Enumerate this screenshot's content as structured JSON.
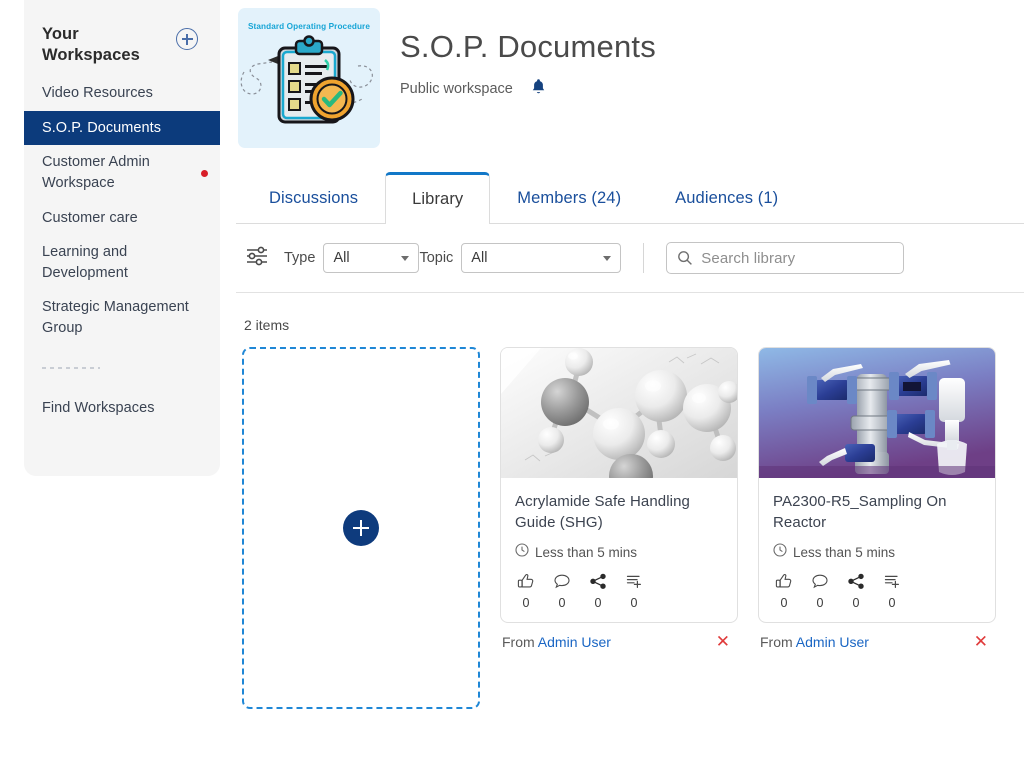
{
  "sidebar": {
    "title": "Your Workspaces",
    "add_icon": "plus-circle-icon",
    "items": [
      {
        "label": "Video Resources",
        "active": false,
        "dot": false
      },
      {
        "label": "S.O.P. Documents",
        "active": true,
        "dot": false
      },
      {
        "label": "Customer Admin Workspace",
        "active": false,
        "dot": true
      },
      {
        "label": "Customer care",
        "active": false,
        "dot": false
      },
      {
        "label": "Learning and Development",
        "active": false,
        "dot": false
      },
      {
        "label": "Strategic Management Group",
        "active": false,
        "dot": false
      }
    ],
    "find_workspaces": "Find Workspaces"
  },
  "header": {
    "thumb_caption": "Standard Operating Procedure",
    "thumb_icon": "clipboard-checklist-icon",
    "title": "S.O.P. Documents",
    "visibility": "Public workspace",
    "bell_icon": "bell-icon"
  },
  "tabs": [
    {
      "label": "Discussions",
      "active": false
    },
    {
      "label": "Library",
      "active": true
    },
    {
      "label": "Members (24)",
      "active": false
    },
    {
      "label": "Audiences (1)",
      "active": false
    }
  ],
  "filters": {
    "filter_icon": "sliders-icon",
    "type_label": "Type",
    "type_value": "All",
    "topic_label": "Topic",
    "topic_value": "All",
    "search_icon": "search-icon",
    "search_value": "",
    "search_placeholder": "Search library"
  },
  "library": {
    "count_label": "2 items",
    "add_tile": {
      "icon": "plus-icon",
      "label": ""
    },
    "items": [
      {
        "title": "Acrylamide Safe Handling Guide (SHG)",
        "duration": "Less than 5 mins",
        "duration_icon": "clock-icon",
        "thumb": "molecule-image",
        "actions": [
          {
            "icon": "thumbs-up-icon",
            "count": "0"
          },
          {
            "icon": "comment-icon",
            "count": "0"
          },
          {
            "icon": "share-icon",
            "count": "0"
          },
          {
            "icon": "add-to-playlist-icon",
            "count": "0"
          }
        ],
        "from_label": "From",
        "author": "Admin User",
        "remove_icon": "close-icon"
      },
      {
        "title": "PA2300-R5_Sampling On Reactor",
        "duration": "Less than 5 mins",
        "duration_icon": "clock-icon",
        "thumb": "reactor-valves-image",
        "actions": [
          {
            "icon": "thumbs-up-icon",
            "count": "0"
          },
          {
            "icon": "comment-icon",
            "count": "0"
          },
          {
            "icon": "share-icon",
            "count": "0"
          },
          {
            "icon": "add-to-playlist-icon",
            "count": "0"
          }
        ],
        "from_label": "From",
        "author": "Admin User",
        "remove_icon": "close-icon"
      }
    ]
  },
  "colors": {
    "sidebar_bg": "#f5f5f5",
    "active_nav": "#0c3b7c",
    "tab_link": "#1a4f9c",
    "tab_active_border": "#1278c8",
    "dashed_border": "#1f87d6",
    "fab": "#0e3b7d",
    "badge_red": "#d81e28",
    "remove_red": "#e03b3b",
    "author_link": "#1a66c4",
    "hero_thumb_bg": "#e3f2fb"
  }
}
